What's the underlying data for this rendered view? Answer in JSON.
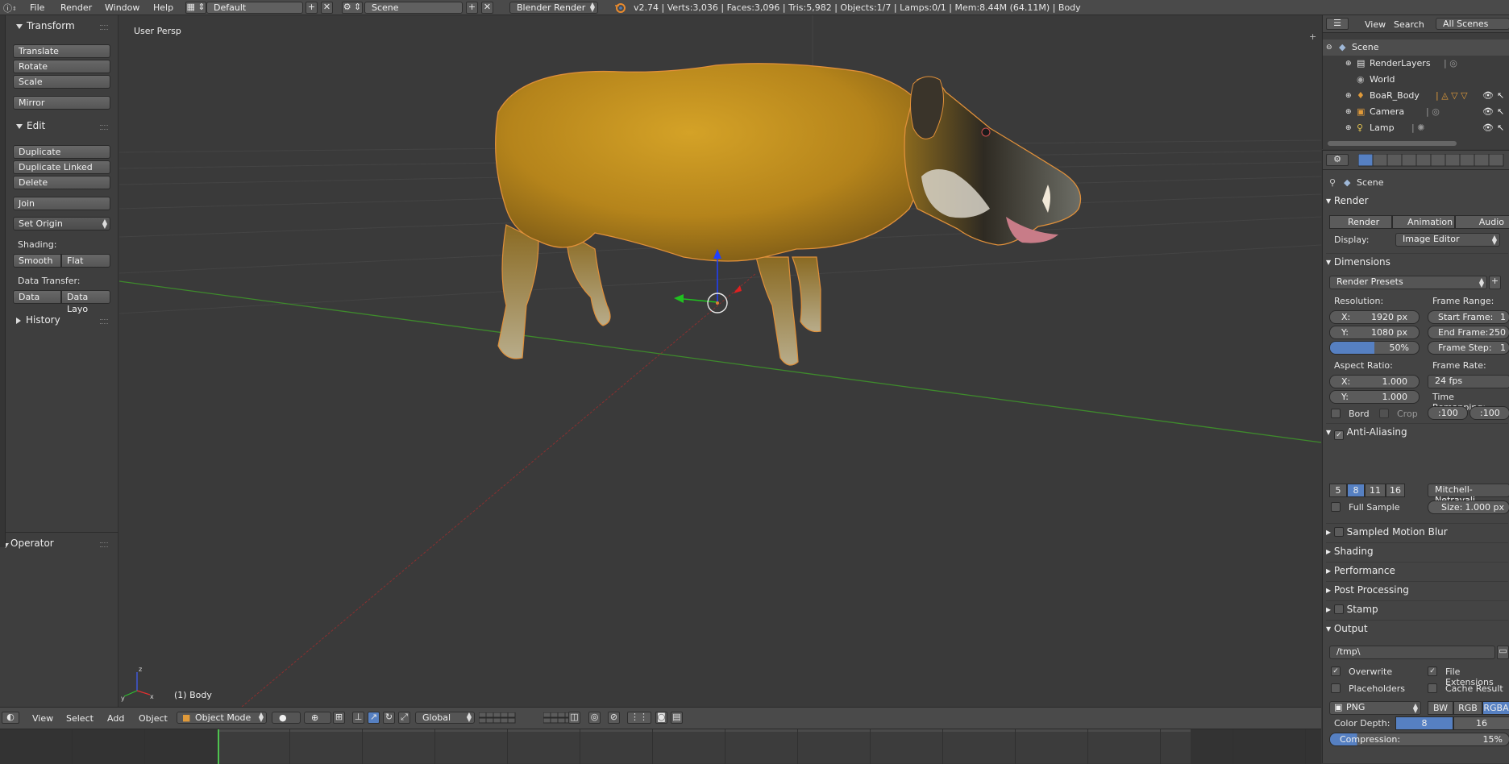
{
  "topbar": {
    "menus": [
      "File",
      "Render",
      "Window",
      "Help"
    ],
    "screen_layout": "Default",
    "scene": "Scene",
    "engine": "Blender Render",
    "stats": "v2.74 | Verts:3,036 | Faces:3,096 | Tris:5,982 | Objects:1/7 | Lamps:0/1 | Mem:8.44M (64.11M) | Body"
  },
  "toolshelf": {
    "transform_title": "Transform",
    "translate": "Translate",
    "rotate": "Rotate",
    "scale": "Scale",
    "mirror": "Mirror",
    "edit_title": "Edit",
    "duplicate": "Duplicate",
    "duplicate_linked": "Duplicate Linked",
    "delete": "Delete",
    "join": "Join",
    "set_origin": "Set Origin",
    "shading_label": "Shading:",
    "smooth": "Smooth",
    "flat": "Flat",
    "data_transfer_label": "Data Transfer:",
    "data": "Data",
    "data_layout": "Data Layo",
    "history_title": "History",
    "operator_title": "Operator"
  },
  "viewport": {
    "view_label": "User Persp",
    "object_label": "(1) Body"
  },
  "bottombar": {
    "menus": [
      "View",
      "Select",
      "Add",
      "Object"
    ],
    "mode": "Object Mode",
    "orientation": "Global"
  },
  "outliner": {
    "view": "View",
    "search": "Search",
    "filter": "All Scenes",
    "items": [
      "Scene",
      "RenderLayers",
      "World",
      "BoaR_Body",
      "Camera",
      "Lamp"
    ]
  },
  "properties": {
    "context": "Scene",
    "render_title": "Render",
    "render_btn": "Render",
    "animation_btn": "Animation",
    "audio_btn": "Audio",
    "display_label": "Display:",
    "display_value": "Image Editor",
    "dimensions_title": "Dimensions",
    "render_presets": "Render Presets",
    "resolution_label": "Resolution:",
    "res_x": "X:",
    "res_x_val": "1920 px",
    "res_y": "Y:",
    "res_y_val": "1080 px",
    "res_pct": "50%",
    "frame_range_label": "Frame Range:",
    "start_frame": "Start Frame:",
    "start_val": "1",
    "end_frame": "End Frame:",
    "end_val": "250",
    "frame_step": "Frame Step:",
    "step_val": "1",
    "aspect_label": "Aspect Ratio:",
    "asp_x": "X:",
    "asp_x_val": "1.000",
    "asp_y": "Y:",
    "asp_y_val": "1.000",
    "frame_rate_label": "Frame Rate:",
    "fps": "24 fps",
    "time_remap_label": "Time Remapping:",
    "remap_old": ":100",
    "remap_new": ":100",
    "bord": "Bord",
    "crop": "Crop",
    "aa_title": "Anti-Aliasing",
    "aa_samples": [
      "5",
      "8",
      "11",
      "16"
    ],
    "aa_filter": "Mitchell-Netravali",
    "full_sample": "Full Sample",
    "size_label": "Size:",
    "size_val": "1.000 px",
    "motion_blur": "Sampled Motion Blur",
    "shading": "Shading",
    "performance": "Performance",
    "post_processing": "Post Processing",
    "stamp": "Stamp",
    "output_title": "Output",
    "output_path": "/tmp\\",
    "overwrite": "Overwrite",
    "file_ext": "File Extensions",
    "placeholders": "Placeholders",
    "cache_result": "Cache Result",
    "format": "PNG",
    "bw": "BW",
    "rgb": "RGB",
    "rgba": "RGBA",
    "color_depth_label": "Color Depth:",
    "depth_8": "8",
    "depth_16": "16",
    "compression_label": "Compression:",
    "compression_val": "15%"
  }
}
